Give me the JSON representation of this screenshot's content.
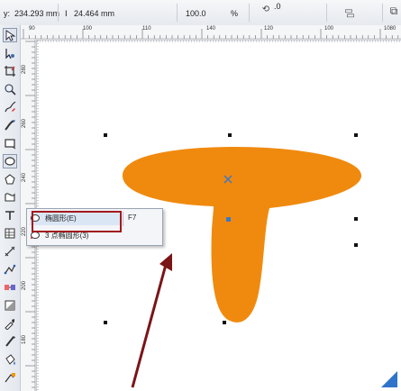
{
  "property_bar": {
    "y_label": "y:",
    "y_value": "234.293 mm",
    "height_value": "24.464 mm",
    "scale_value": "100.0",
    "scale_unit": "%",
    "rotation_value": ".0"
  },
  "ruler": {
    "h_labels": [
      "90",
      "100",
      "110",
      "140",
      "120",
      "100",
      "1080"
    ],
    "v_labels": [
      "280",
      "260",
      "240",
      "220",
      "200",
      "180"
    ]
  },
  "flyout": {
    "item1_label": "椭圆形(E)",
    "item1_shortcut": "F7",
    "item2_label": "3 点椭圆形(3)"
  },
  "colors": {
    "shape_fill": "#f08a0e",
    "annotation_red": "#a2191d",
    "arrow": "#7a1518",
    "center_marker": "#3a78c9"
  },
  "icons": [
    "pick-tool-icon",
    "shape-tool-icon",
    "crop-tool-icon",
    "zoom-tool-icon",
    "freehand-tool-icon",
    "artistic-media-icon",
    "rectangle-tool-icon",
    "ellipse-tool-icon",
    "polygon-tool-icon",
    "text-tool-icon",
    "table-tool-icon",
    "dimension-tool-icon",
    "connector-tool-icon",
    "blend-tool-icon",
    "eyedropper-tool-icon",
    "fill-tool-icon"
  ]
}
